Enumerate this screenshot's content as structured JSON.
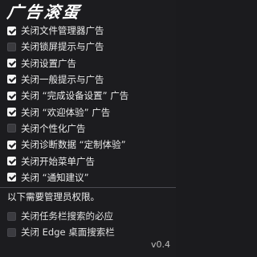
{
  "app": {
    "title": "广告滚蛋",
    "version": "v0.4"
  },
  "options": [
    {
      "label": "关闭文件管理器广告",
      "checked": true
    },
    {
      "label": "关闭锁屏提示与广告",
      "checked": false
    },
    {
      "label": "关闭设置广告",
      "checked": true
    },
    {
      "label": "关闭一般提示与广告",
      "checked": true
    },
    {
      "label": "关闭 “完成设备设置” 广告",
      "checked": true
    },
    {
      "label": "关闭 “欢迎体验” 广告",
      "checked": true
    },
    {
      "label": "关闭个性化广告",
      "checked": false
    },
    {
      "label": "关闭诊断数据 “定制体验”",
      "checked": true
    },
    {
      "label": "关闭开始菜单广告",
      "checked": true
    },
    {
      "label": "关闭 “通知建议”",
      "checked": true
    }
  ],
  "admin": {
    "note": "以下需要管理员权限。",
    "options": [
      {
        "label": "关闭任务栏搜索的必应",
        "checked": false
      },
      {
        "label": "关闭 Edge 桌面搜索栏",
        "checked": false
      }
    ]
  }
}
